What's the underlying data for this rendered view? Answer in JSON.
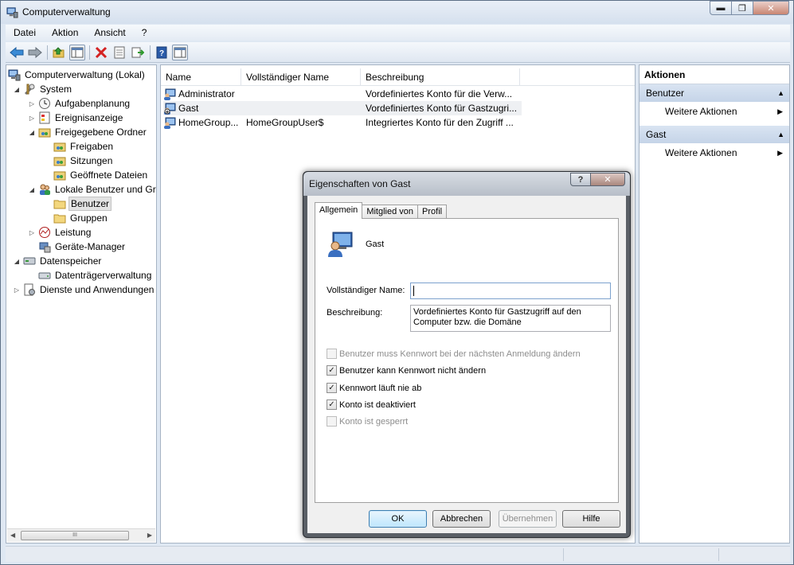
{
  "window": {
    "title": "Computerverwaltung"
  },
  "menu": {
    "items": [
      "Datei",
      "Aktion",
      "Ansicht",
      "?"
    ]
  },
  "tree": {
    "items": [
      {
        "label": "Computerverwaltung (Lokal)",
        "icon": "computer-management-icon"
      },
      {
        "label": "System",
        "icon": "tools-icon"
      },
      {
        "label": "Aufgabenplanung",
        "icon": "clock-icon"
      },
      {
        "label": "Ereignisanzeige",
        "icon": "event-viewer-icon"
      },
      {
        "label": "Freigegebene Ordner",
        "icon": "shared-folder-icon"
      },
      {
        "label": "Freigaben",
        "icon": "shared-folder-icon"
      },
      {
        "label": "Sitzungen",
        "icon": "shared-folder-icon"
      },
      {
        "label": "Geöffnete Dateien",
        "icon": "shared-folder-icon"
      },
      {
        "label": "Lokale Benutzer und Gr",
        "icon": "users-icon"
      },
      {
        "label": "Benutzer",
        "icon": "folder-icon"
      },
      {
        "label": "Gruppen",
        "icon": "folder-icon"
      },
      {
        "label": "Leistung",
        "icon": "performance-icon"
      },
      {
        "label": "Geräte-Manager",
        "icon": "device-manager-icon"
      },
      {
        "label": "Datenspeicher",
        "icon": "storage-icon"
      },
      {
        "label": "Datenträgerverwaltung",
        "icon": "disk-icon"
      },
      {
        "label": "Dienste und Anwendungen",
        "icon": "services-icon"
      }
    ],
    "scroll_grip": "III"
  },
  "list": {
    "columns": [
      "Name",
      "Vollständiger Name",
      "Beschreibung"
    ],
    "rows": [
      {
        "name": "Administrator",
        "full_name": "",
        "description": "Vordefiniertes Konto für die Verw..."
      },
      {
        "name": "Gast",
        "full_name": "",
        "description": "Vordefiniertes Konto für Gastzugri..."
      },
      {
        "name": "HomeGroup...",
        "full_name": "HomeGroupUser$",
        "description": "Integriertes Konto für den Zugriff ..."
      }
    ]
  },
  "actions": {
    "header": "Aktionen",
    "sections": [
      {
        "title": "Benutzer",
        "item": "Weitere Aktionen"
      },
      {
        "title": "Gast",
        "item": "Weitere Aktionen"
      }
    ]
  },
  "dialog": {
    "title": "Eigenschaften von Gast",
    "help_glyph": "?",
    "close_glyph": "✕",
    "tabs": [
      "Allgemein",
      "Mitglied von",
      "Profil"
    ],
    "username": "Gast",
    "full_name_label": "Vollständiger Name:",
    "full_name_value": "",
    "description_label": "Beschreibung:",
    "description_value": "Vordefiniertes Konto für Gastzugriff auf den Computer bzw. die Domäne",
    "checkboxes": [
      {
        "label": "Benutzer muss Kennwort bei der nächsten Anmeldung ändern",
        "checked": false,
        "enabled": false
      },
      {
        "label": "Benutzer kann Kennwort nicht ändern",
        "checked": true,
        "enabled": true
      },
      {
        "label": "Kennwort läuft nie ab",
        "checked": true,
        "enabled": true
      },
      {
        "label": "Konto ist deaktiviert",
        "checked": true,
        "enabled": true
      },
      {
        "label": "Konto ist gesperrt",
        "checked": false,
        "enabled": false
      }
    ],
    "buttons": {
      "ok": "OK",
      "cancel": "Abbrechen",
      "apply": "Übernehmen",
      "help": "Hilfe"
    }
  }
}
